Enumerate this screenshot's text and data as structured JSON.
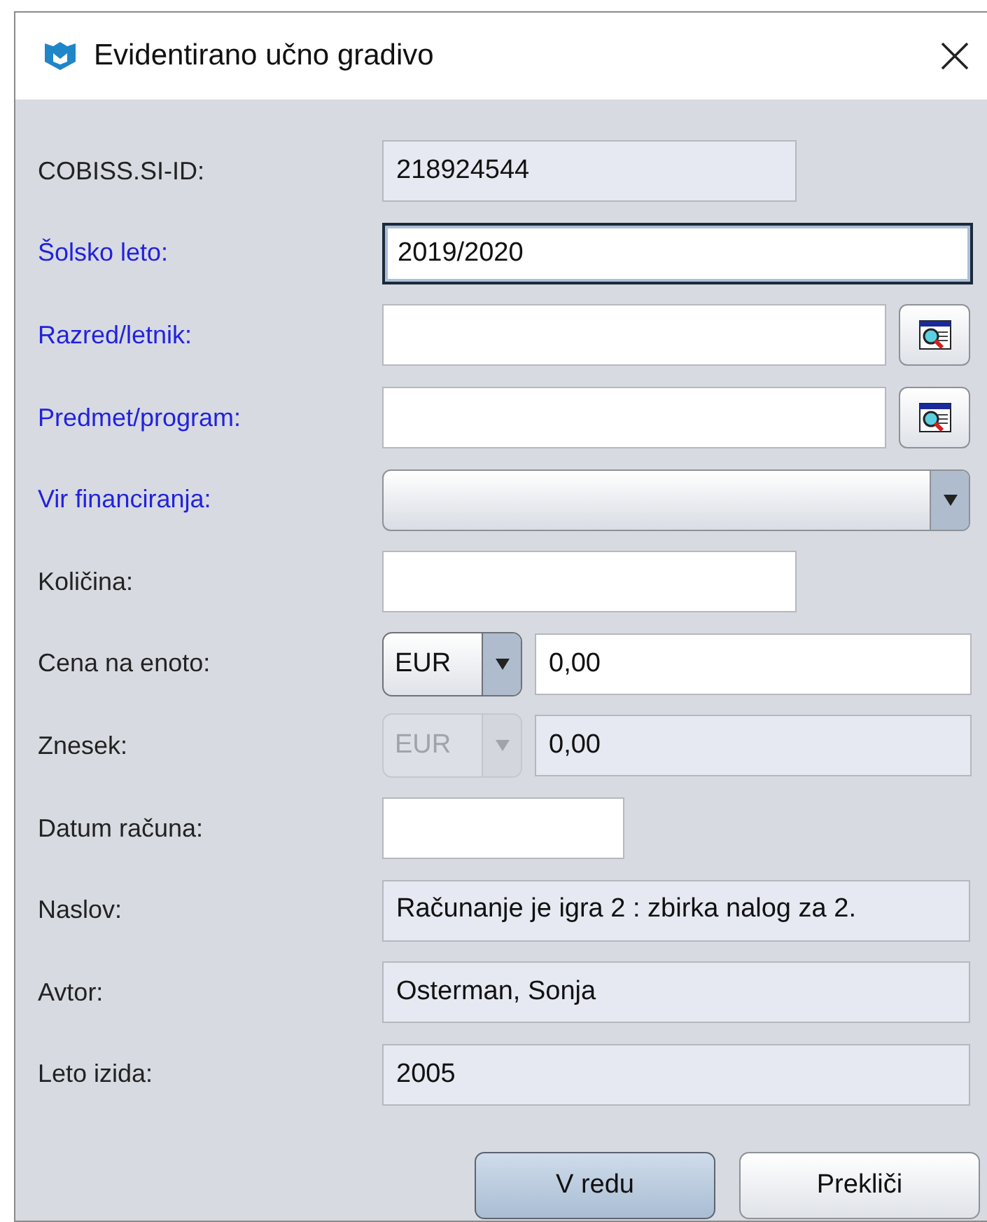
{
  "window": {
    "title": "Evidentirano učno gradivo"
  },
  "fields": [
    {
      "kind": "text",
      "label": "COBISS.SI-ID:",
      "required": false,
      "value": "218924544",
      "readonly": true,
      "focused": false
    },
    {
      "kind": "text",
      "label": "Šolsko leto:",
      "required": true,
      "value": "2019/2020",
      "readonly": false,
      "focused": true
    },
    {
      "kind": "lookup",
      "label": "Razred/letnik:",
      "required": true,
      "readonly": false,
      "focused": false
    },
    {
      "kind": "lookup",
      "label": "Predmet/program:",
      "required": true,
      "readonly": false,
      "focused": false
    },
    {
      "kind": "combo",
      "label": "Vir financiranja:",
      "required": true
    },
    {
      "kind": "text",
      "label": "Količina:",
      "required": false,
      "readonly": false,
      "focused": false
    },
    {
      "kind": "currency",
      "label": "Cena na enoto:",
      "required": false,
      "currency": "EUR",
      "value": "0,00",
      "readonly": false,
      "disabled": false,
      "focused": false
    },
    {
      "kind": "currency",
      "label": "Znesek:",
      "required": false,
      "currency": "EUR",
      "value": "0,00",
      "readonly": true,
      "disabled": true,
      "focused": false
    },
    {
      "kind": "text",
      "label": "Datum računa:",
      "required": false,
      "readonly": false,
      "focused": false
    },
    {
      "kind": "text",
      "label": "Naslov:",
      "required": false,
      "value": "Računanje je igra 2 : zbirka nalog za 2.",
      "readonly": true,
      "focused": false
    },
    {
      "kind": "text",
      "label": "Avtor:",
      "required": false,
      "value": "Osterman, Sonja",
      "readonly": true,
      "focused": false
    },
    {
      "kind": "text",
      "label": "Leto izida:",
      "required": false,
      "value": "2005",
      "readonly": true,
      "focused": false
    }
  ],
  "buttons": [
    {
      "label": "V redu",
      "default": true
    },
    {
      "label": "Prekliči",
      "default": false
    }
  ]
}
